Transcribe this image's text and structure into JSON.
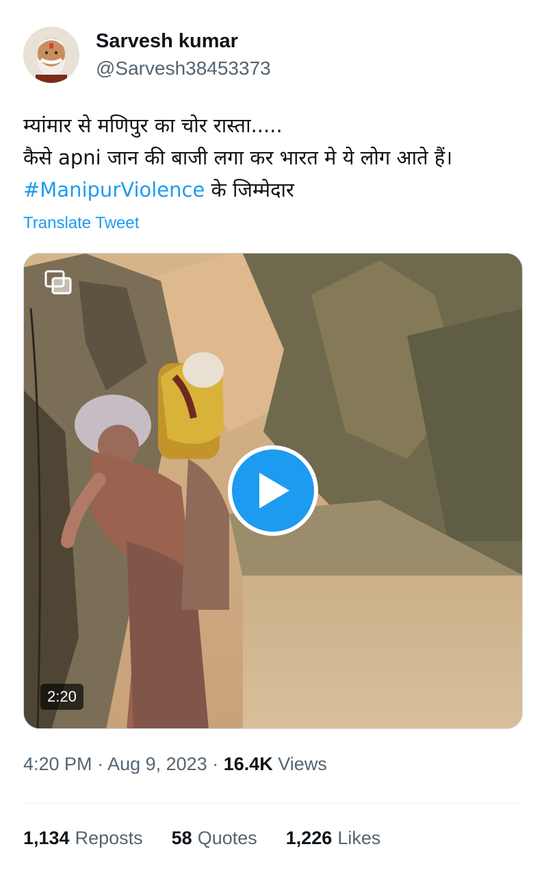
{
  "author": {
    "name": "Sarvesh kumar",
    "handle": "@Sarvesh38453373",
    "avatar_icon": "avatar-portrait"
  },
  "tweet": {
    "lines": [
      "म्यांमार से मणिपुर का चोर रास्ता.....",
      "कैसे apni जान की बाजी लगा कर भारत मे ये लोग आते हैं।"
    ],
    "hashtag": "#ManipurViolence",
    "hashtag_suffix": " के जिम्मेदार",
    "translate_label": "Translate Tweet"
  },
  "media": {
    "duration": "2:20",
    "play_icon": "play-icon",
    "gif_icon": "gif-icon"
  },
  "meta": {
    "time": "4:20 PM",
    "separator1": " · ",
    "date": "Aug 9, 2023",
    "separator2": " · ",
    "views_count": "16.4K",
    "views_label": " Views"
  },
  "stats": {
    "reposts_count": "1,134",
    "reposts_label": "Reposts",
    "quotes_count": "58",
    "quotes_label": "Quotes",
    "likes_count": "1,226",
    "likes_label": "Likes"
  },
  "colors": {
    "accent": "#1d9bf0",
    "text": "#0f1419",
    "secondary": "#536471"
  }
}
